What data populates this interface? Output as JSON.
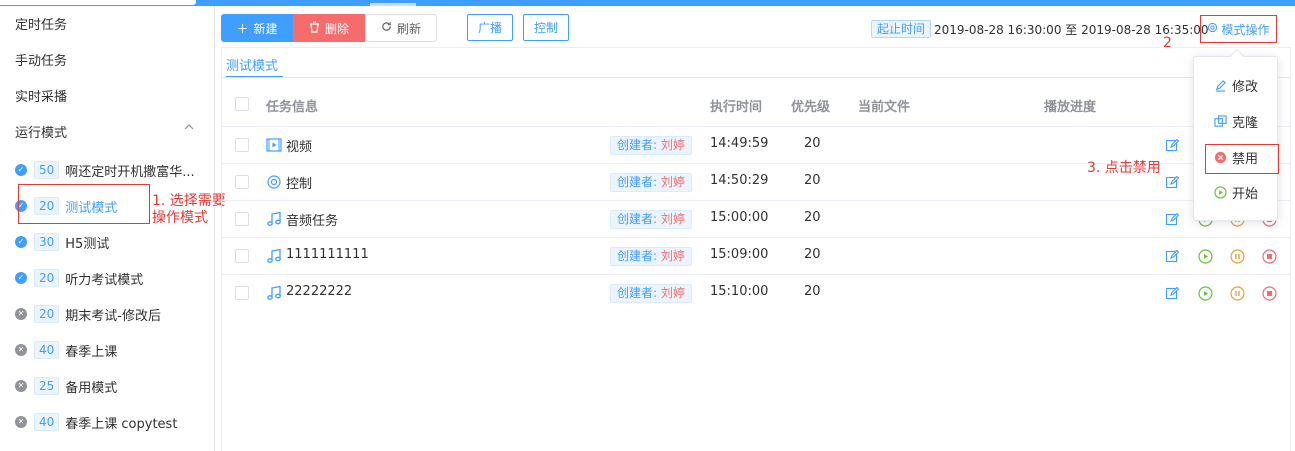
{
  "sidebar": {
    "menu": [
      "定时任务",
      "手动任务",
      "实时采播",
      "运行模式"
    ],
    "modes": [
      {
        "num": "50",
        "name": "啊还定时开机撒富华...",
        "enabled": true,
        "active": false
      },
      {
        "num": "20",
        "name": "测试模式",
        "enabled": true,
        "active": true
      },
      {
        "num": "30",
        "name": "H5测试",
        "enabled": true,
        "active": false
      },
      {
        "num": "20",
        "name": "听力考试模式",
        "enabled": true,
        "active": false
      },
      {
        "num": "20",
        "name": "期末考试-修改后",
        "enabled": false,
        "active": false
      },
      {
        "num": "40",
        "name": "春季上课",
        "enabled": false,
        "active": false
      },
      {
        "num": "25",
        "name": "备用模式",
        "enabled": false,
        "active": false
      },
      {
        "num": "40",
        "name": "春季上课 copytest",
        "enabled": false,
        "active": false
      }
    ]
  },
  "toolbar": {
    "new_label": "新建",
    "delete_label": "删除",
    "refresh_label": "刷新",
    "broadcast_label": "广播",
    "control_label": "控制",
    "time_tag": "起止时间",
    "time_range": "2019-08-28 16:30:00 至 2019-08-28 16:35:00",
    "mode_op_label": "模式操作"
  },
  "tab": {
    "label": "测试模式"
  },
  "table": {
    "headers": {
      "info": "任务信息",
      "time": "执行时间",
      "priority": "优先级",
      "file": "当前文件",
      "progress": "播放进度"
    },
    "rows": [
      {
        "icon": "video",
        "name": "视频",
        "creator_label": "创建者: ",
        "creator": "刘婷",
        "time": "14:49:59",
        "priority": "20"
      },
      {
        "icon": "control",
        "name": "控制",
        "creator_label": "创建者: ",
        "creator": "刘婷",
        "time": "14:50:29",
        "priority": "20"
      },
      {
        "icon": "music",
        "name": "音频任务",
        "creator_label": "创建者: ",
        "creator": "刘婷",
        "time": "15:00:00",
        "priority": "20"
      },
      {
        "icon": "music",
        "name": "1111111111",
        "creator_label": "创建者: ",
        "creator": "刘婷",
        "time": "15:09:00",
        "priority": "20"
      },
      {
        "icon": "music",
        "name": "22222222",
        "creator_label": "创建者: ",
        "creator": "刘婷",
        "time": "15:10:00",
        "priority": "20"
      }
    ]
  },
  "dropdown": {
    "items": [
      {
        "label": "修改",
        "icon": "edit-icon"
      },
      {
        "label": "克隆",
        "icon": "clone-icon"
      },
      {
        "label": "禁用",
        "icon": "disable-icon"
      },
      {
        "label": "开始",
        "icon": "play-icon"
      }
    ]
  },
  "annotations": {
    "step1_line1": "1. 选择需要",
    "step1_line2": "操作模式",
    "step2": "2",
    "step3": "3. 点击禁用"
  },
  "colors": {
    "primary": "#409eff",
    "danger": "#f56c6c",
    "warning": "#e6a23c",
    "success": "#67c23a",
    "annotation": "#e53935"
  }
}
